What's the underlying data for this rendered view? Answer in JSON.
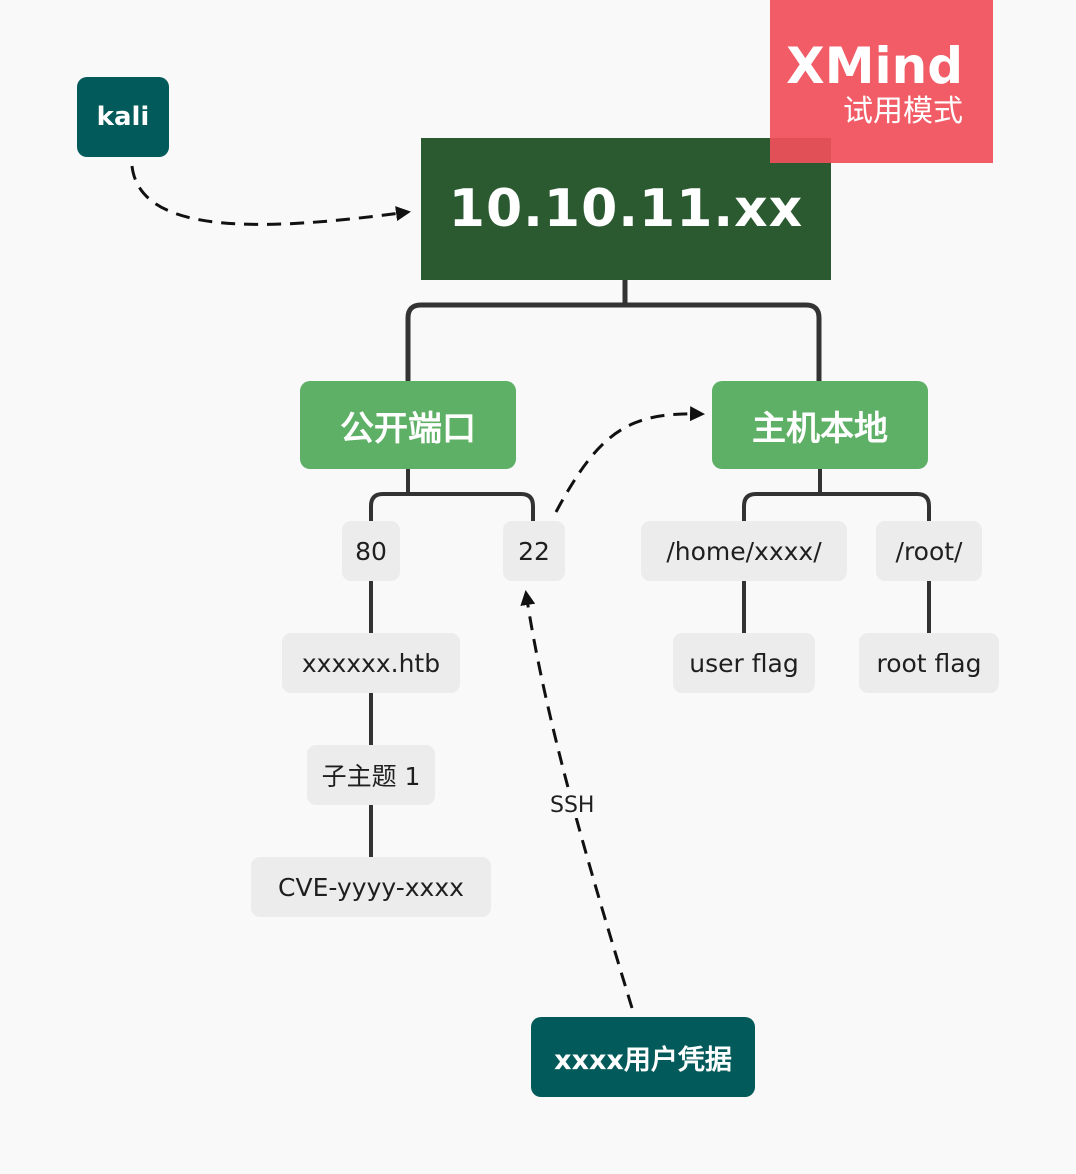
{
  "root": {
    "label": "10.10.11.xx"
  },
  "topics": {
    "public_ports": "公开端口",
    "host_local": "主机本地"
  },
  "ports": {
    "port_80": "80",
    "port_22": "22",
    "domain": "xxxxxx.htb",
    "subtopic": "子主题 1",
    "cve": "CVE-yyyy-xxxx"
  },
  "host": {
    "home_dir": "/home/xxxx/",
    "root_dir": "/root/",
    "user_flag": "user flag",
    "root_flag": "root flag"
  },
  "floating": {
    "kali": "kali",
    "creds": "xxxx用户凭据"
  },
  "relations": {
    "ssh_label": "SSH"
  },
  "watermark": {
    "brand": "XMind",
    "mode": "试用模式"
  },
  "colors": {
    "root": "#2b5a31",
    "main_topic": "#5fb067",
    "subtopic": "#ececec",
    "floating": "#035a5a",
    "watermark": "#f0505a",
    "connector": "#333333"
  }
}
